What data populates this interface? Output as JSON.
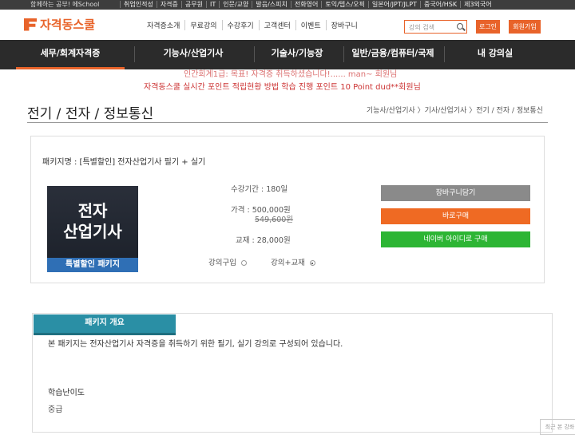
{
  "topbar": {
    "left_text": "함께하는 공부! 에School",
    "links": [
      "취업인적성",
      "자격증",
      "공무원",
      "IT",
      "인문/교양",
      "발음/스피치",
      "전화영어",
      "토익/텝스/오픽",
      "일본어/JPT/JLPT",
      "중국어/HSK",
      "제3외국어"
    ]
  },
  "header": {
    "logo_text": "자격동스쿨",
    "nav": [
      "자격증소개",
      "무료강의",
      "수강후기",
      "고객센터",
      "이벤트",
      "장바구니"
    ],
    "search_placeholder": "강의 검색",
    "login_label": "로그인",
    "join_label": "회원가입"
  },
  "mainnav": {
    "items": [
      "세무/회계자격증",
      "기능사/산업기사",
      "기술사/기능장",
      "일반/금융/컴퓨터/국제",
      "내 강의실"
    ]
  },
  "ticker": {
    "line1": "인간회계1급: 목표! 자격증 취득하셨습니다!...... man~ 회원님",
    "line2": "자격동스쿨 실시간 포인트 적립현황 방법 학습 진행 포인트 10 Point dud**회원님"
  },
  "page": {
    "title": "전기 / 전자 / 정보통신",
    "breadcrumb": "기능사/산업기사 〉기사/산업기사 〉전기 / 전자 / 정보통신"
  },
  "package": {
    "name": "패키지명 : [특별할인] 전자산업기사 필기 + 실기",
    "thumb_line1": "전자",
    "thumb_line2": "산업기사",
    "thumb_tag": "특별할인 패키지",
    "period": "수강기간 : 180일",
    "price": "가격 : 500,000원",
    "original_price": "549,600원",
    "textbook": "교재 : 28,000원",
    "option_lecture": "강의구입",
    "option_lecture_book": "강의+교재",
    "selected_option": "강의+교재",
    "cart_btn": "장바구니담기",
    "buy_btn": "바로구매",
    "naver_btn": "네이버 아이디로 구매",
    "colors": {
      "cart": "#8a8a8a",
      "buy": "#ef6a23",
      "naver": "#2db534"
    }
  },
  "overview": {
    "tab_label": "패키지 개요",
    "description": "본 패키지는 전자산업기사 자격증을 취득하기 위한 필기, 실기 강의로 구성되어 있습니다.",
    "level_label": "학습난이도",
    "level_value": "중급",
    "corner_text": "최근 본 강좌"
  }
}
